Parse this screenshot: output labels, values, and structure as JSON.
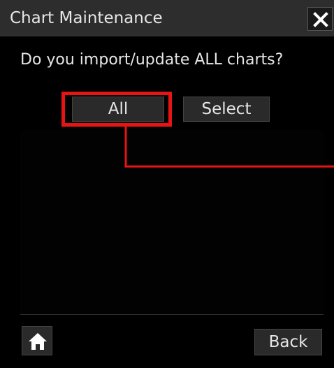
{
  "dialog": {
    "title": "Chart Maintenance",
    "close_icon": "close-x-icon",
    "question": "Do you import/update ALL charts?"
  },
  "buttons": {
    "all_label": "All",
    "select_label": "Select",
    "back_label": "Back"
  },
  "footer": {
    "home_icon": "home-icon"
  },
  "annotation": {
    "highlight_color": "#e81414",
    "highlighted_control": "All"
  },
  "colors": {
    "background": "#000000",
    "titlebar": "#2d2d2d",
    "button": "#2a2a2a",
    "text": "#e6e6e6"
  }
}
